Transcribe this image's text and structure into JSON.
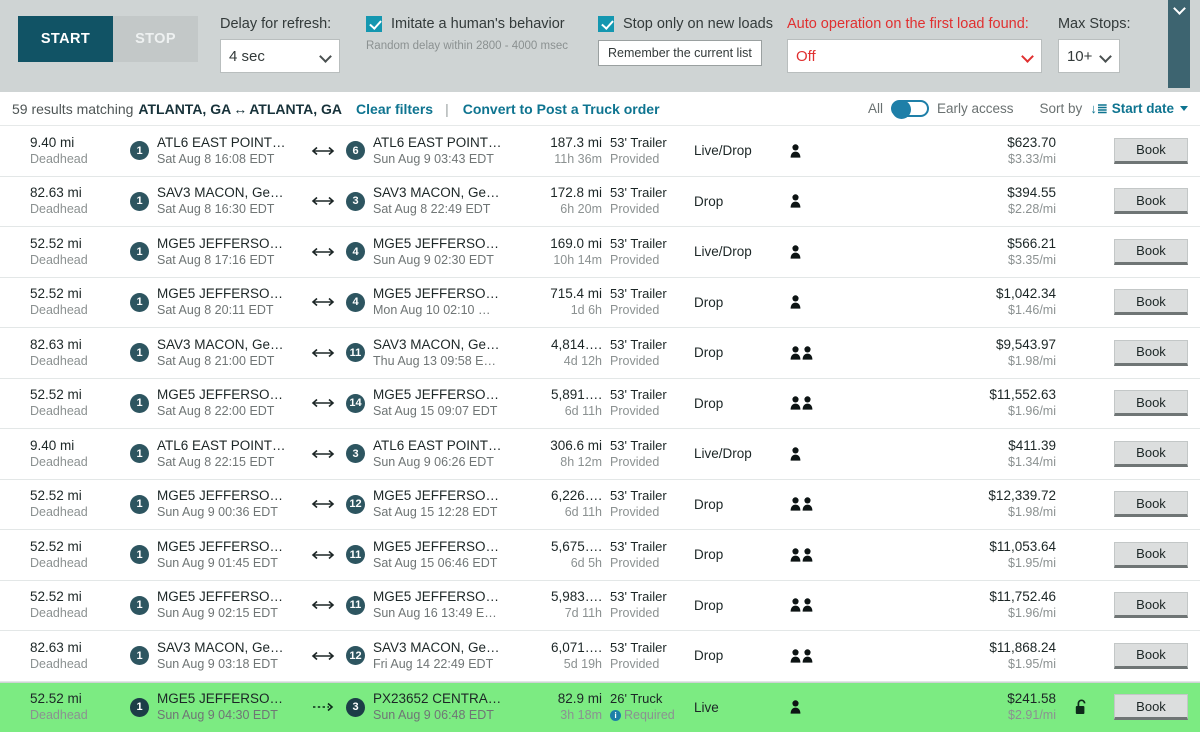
{
  "toolbar": {
    "start_label": "START",
    "stop_label": "STOP",
    "delay_label": "Delay for refresh:",
    "delay_value": "4 sec",
    "imitate_label": "Imitate a human's behavior",
    "imitate_sub": "Random delay within 2800 - 4000 msec",
    "stop_new_loads_label": "Stop only on new loads",
    "remember_label": "Remember the current list",
    "auto_op_label": "Auto operation on the first load found:",
    "auto_op_value": "Off",
    "max_stops_label": "Max Stops:",
    "max_stops_value": "10+",
    "accent_teal": "#115365",
    "accent_cyan": "#1497b0",
    "accent_red": "#e03030"
  },
  "results": {
    "count_text": "59 results matching",
    "origin": "ATLANTA, GA",
    "swap_icon": "↔",
    "destination": "ATLANTA, GA",
    "clear_filters": "Clear filters",
    "pipe": "|",
    "convert_link": "Convert to Post a Truck order",
    "toggle_left": "All",
    "toggle_right": "Early access",
    "sort_by_label": "Sort by",
    "sort_value": "Start date"
  },
  "book_label": "Book",
  "rows": [
    {
      "deadhead": "9.40 mi",
      "deadhead_sub": "Deadhead",
      "orig_badge": "1",
      "orig_name": "ATL6 EAST POINT…",
      "orig_time": "Sat Aug 8 16:08 EDT",
      "arrow": "double",
      "dest_badge": "6",
      "dest_name": "ATL6 EAST POINT…",
      "dest_time": "Sun Aug 9 03:43 EDT",
      "dist": "187.3 mi",
      "dur": "11h 36m",
      "equip": "53' Trailer",
      "equip_sub": "Provided",
      "equip_req": false,
      "type": "Live/Drop",
      "people": 1,
      "rate": "$623.70",
      "rpm": "$3.33/mi",
      "lock": false,
      "highlight": false
    },
    {
      "deadhead": "82.63 mi",
      "deadhead_sub": "Deadhead",
      "orig_badge": "1",
      "orig_name": "SAV3 MACON, Ge…",
      "orig_time": "Sat Aug 8 16:30 EDT",
      "arrow": "double",
      "dest_badge": "3",
      "dest_name": "SAV3 MACON, Ge…",
      "dest_time": "Sat Aug 8 22:49 EDT",
      "dist": "172.8 mi",
      "dur": "6h 20m",
      "equip": "53' Trailer",
      "equip_sub": "Provided",
      "equip_req": false,
      "type": "Drop",
      "people": 1,
      "rate": "$394.55",
      "rpm": "$2.28/mi",
      "lock": false,
      "highlight": false
    },
    {
      "deadhead": "52.52 mi",
      "deadhead_sub": "Deadhead",
      "orig_badge": "1",
      "orig_name": "MGE5 JEFFERSO…",
      "orig_time": "Sat Aug 8 17:16 EDT",
      "arrow": "double",
      "dest_badge": "4",
      "dest_name": "MGE5 JEFFERSO…",
      "dest_time": "Sun Aug 9 02:30 EDT",
      "dist": "169.0 mi",
      "dur": "10h 14m",
      "equip": "53' Trailer",
      "equip_sub": "Provided",
      "equip_req": false,
      "type": "Live/Drop",
      "people": 1,
      "rate": "$566.21",
      "rpm": "$3.35/mi",
      "lock": false,
      "highlight": false
    },
    {
      "deadhead": "52.52 mi",
      "deadhead_sub": "Deadhead",
      "orig_badge": "1",
      "orig_name": "MGE5 JEFFERSO…",
      "orig_time": "Sat Aug 8 20:11 EDT",
      "arrow": "double",
      "dest_badge": "4",
      "dest_name": "MGE5 JEFFERSO…",
      "dest_time": "Mon Aug 10 02:10 …",
      "dist": "715.4 mi",
      "dur": "1d 6h",
      "equip": "53' Trailer",
      "equip_sub": "Provided",
      "equip_req": false,
      "type": "Drop",
      "people": 1,
      "rate": "$1,042.34",
      "rpm": "$1.46/mi",
      "lock": false,
      "highlight": false
    },
    {
      "deadhead": "82.63 mi",
      "deadhead_sub": "Deadhead",
      "orig_badge": "1",
      "orig_name": "SAV3 MACON, Ge…",
      "orig_time": "Sat Aug 8 21:00 EDT",
      "arrow": "double",
      "dest_badge": "11",
      "dest_name": "SAV3 MACON, Ge…",
      "dest_time": "Thu Aug 13 09:58 E…",
      "dist": "4,814….",
      "dur": "4d 12h",
      "equip": "53' Trailer",
      "equip_sub": "Provided",
      "equip_req": false,
      "type": "Drop",
      "people": 2,
      "rate": "$9,543.97",
      "rpm": "$1.98/mi",
      "lock": false,
      "highlight": false
    },
    {
      "deadhead": "52.52 mi",
      "deadhead_sub": "Deadhead",
      "orig_badge": "1",
      "orig_name": "MGE5 JEFFERSO…",
      "orig_time": "Sat Aug 8 22:00 EDT",
      "arrow": "double",
      "dest_badge": "14",
      "dest_name": "MGE5 JEFFERSO…",
      "dest_time": "Sat Aug 15 09:07 EDT",
      "dist": "5,891….",
      "dur": "6d 11h",
      "equip": "53' Trailer",
      "equip_sub": "Provided",
      "equip_req": false,
      "type": "Drop",
      "people": 2,
      "rate": "$11,552.63",
      "rpm": "$1.96/mi",
      "lock": false,
      "highlight": false
    },
    {
      "deadhead": "9.40 mi",
      "deadhead_sub": "Deadhead",
      "orig_badge": "1",
      "orig_name": "ATL6 EAST POINT…",
      "orig_time": "Sat Aug 8 22:15 EDT",
      "arrow": "double",
      "dest_badge": "3",
      "dest_name": "ATL6 EAST POINT…",
      "dest_time": "Sun Aug 9 06:26 EDT",
      "dist": "306.6 mi",
      "dur": "8h 12m",
      "equip": "53' Trailer",
      "equip_sub": "Provided",
      "equip_req": false,
      "type": "Live/Drop",
      "people": 1,
      "rate": "$411.39",
      "rpm": "$1.34/mi",
      "lock": false,
      "highlight": false
    },
    {
      "deadhead": "52.52 mi",
      "deadhead_sub": "Deadhead",
      "orig_badge": "1",
      "orig_name": "MGE5 JEFFERSO…",
      "orig_time": "Sun Aug 9 00:36 EDT",
      "arrow": "double",
      "dest_badge": "12",
      "dest_name": "MGE5 JEFFERSO…",
      "dest_time": "Sat Aug 15 12:28 EDT",
      "dist": "6,226….",
      "dur": "6d 11h",
      "equip": "53' Trailer",
      "equip_sub": "Provided",
      "equip_req": false,
      "type": "Drop",
      "people": 2,
      "rate": "$12,339.72",
      "rpm": "$1.98/mi",
      "lock": false,
      "highlight": false
    },
    {
      "deadhead": "52.52 mi",
      "deadhead_sub": "Deadhead",
      "orig_badge": "1",
      "orig_name": "MGE5 JEFFERSO…",
      "orig_time": "Sun Aug 9 01:45 EDT",
      "arrow": "double",
      "dest_badge": "11",
      "dest_name": "MGE5 JEFFERSO…",
      "dest_time": "Sat Aug 15 06:46 EDT",
      "dist": "5,675….",
      "dur": "6d 5h",
      "equip": "53' Trailer",
      "equip_sub": "Provided",
      "equip_req": false,
      "type": "Drop",
      "people": 2,
      "rate": "$11,053.64",
      "rpm": "$1.95/mi",
      "lock": false,
      "highlight": false
    },
    {
      "deadhead": "52.52 mi",
      "deadhead_sub": "Deadhead",
      "orig_badge": "1",
      "orig_name": "MGE5 JEFFERSO…",
      "orig_time": "Sun Aug 9 02:15 EDT",
      "arrow": "double",
      "dest_badge": "11",
      "dest_name": "MGE5 JEFFERSO…",
      "dest_time": "Sun Aug 16 13:49 E…",
      "dist": "5,983….",
      "dur": "7d 11h",
      "equip": "53' Trailer",
      "equip_sub": "Provided",
      "equip_req": false,
      "type": "Drop",
      "people": 2,
      "rate": "$11,752.46",
      "rpm": "$1.96/mi",
      "lock": false,
      "highlight": false
    },
    {
      "deadhead": "82.63 mi",
      "deadhead_sub": "Deadhead",
      "orig_badge": "1",
      "orig_name": "SAV3 MACON, Ge…",
      "orig_time": "Sun Aug 9 03:18 EDT",
      "arrow": "double",
      "dest_badge": "12",
      "dest_name": "SAV3 MACON, Ge…",
      "dest_time": "Fri Aug 14 22:49 EDT",
      "dist": "6,071….",
      "dur": "5d 19h",
      "equip": "53' Trailer",
      "equip_sub": "Provided",
      "equip_req": false,
      "type": "Drop",
      "people": 2,
      "rate": "$11,868.24",
      "rpm": "$1.95/mi",
      "lock": false,
      "highlight": false
    },
    {
      "deadhead": "52.52 mi",
      "deadhead_sub": "Deadhead",
      "orig_badge": "1",
      "orig_name": "MGE5 JEFFERSO…",
      "orig_time": "Sun Aug 9 04:30 EDT",
      "arrow": "dotted",
      "dest_badge": "3",
      "dest_name": "PX23652 CENTRA…",
      "dest_time": "Sun Aug 9 06:48 EDT",
      "dist": "82.9 mi",
      "dur": "3h 18m",
      "equip": "26' Truck",
      "equip_sub": "Required",
      "equip_req": true,
      "type": "Live",
      "people": 1,
      "rate": "$241.58",
      "rpm": "$2.91/mi",
      "lock": true,
      "highlight": true
    }
  ]
}
